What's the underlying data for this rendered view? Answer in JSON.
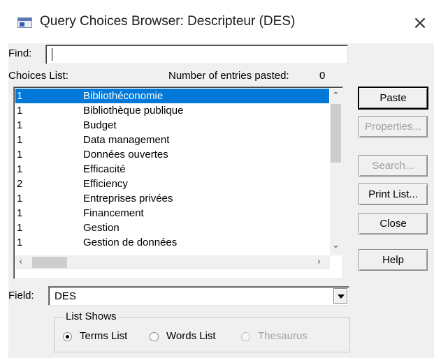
{
  "window": {
    "title": "Query Choices Browser: Descripteur (DES)",
    "close_glyph": "×"
  },
  "find": {
    "label": "Find:",
    "value": ""
  },
  "choices": {
    "label": "Choices List:",
    "pasted_label": "Number of entries pasted:",
    "pasted_count": "0",
    "selected_index": 0,
    "rows": [
      {
        "count": "1",
        "term": "Bibliothéconomie"
      },
      {
        "count": "1",
        "term": "Bibliothèque publique"
      },
      {
        "count": "1",
        "term": "Budget"
      },
      {
        "count": "1",
        "term": "Data management"
      },
      {
        "count": "1",
        "term": "Données ouvertes"
      },
      {
        "count": "1",
        "term": "Efficacité"
      },
      {
        "count": "2",
        "term": "Efficiency"
      },
      {
        "count": "1",
        "term": "Entreprises privées"
      },
      {
        "count": "1",
        "term": "Financement"
      },
      {
        "count": "1",
        "term": "Gestion"
      },
      {
        "count": "1",
        "term": "Gestion de données"
      }
    ]
  },
  "buttons": {
    "paste": "Paste",
    "properties": "Properties...",
    "search": "Search...",
    "print_list": "Print List...",
    "close": "Close",
    "help": "Help"
  },
  "field": {
    "label": "Field:",
    "value": "DES"
  },
  "list_shows": {
    "label": "List Shows",
    "options": [
      {
        "label": "Terms List",
        "checked": true,
        "enabled": true
      },
      {
        "label": "Words List",
        "checked": false,
        "enabled": true
      },
      {
        "label": "Thesaurus",
        "checked": false,
        "enabled": false
      }
    ]
  },
  "icons": {
    "app": "window-icon",
    "close": "close-icon",
    "scroll_up": "chevron-up-icon",
    "scroll_down": "chevron-down-icon",
    "scroll_left": "chevron-left-icon",
    "scroll_right": "chevron-right-icon",
    "dropdown": "dropdown-arrow-icon"
  },
  "colors": {
    "selection": "#0078d7",
    "disabled_text": "#a0a0a0",
    "dialog_bg": "#f0f0f0"
  }
}
